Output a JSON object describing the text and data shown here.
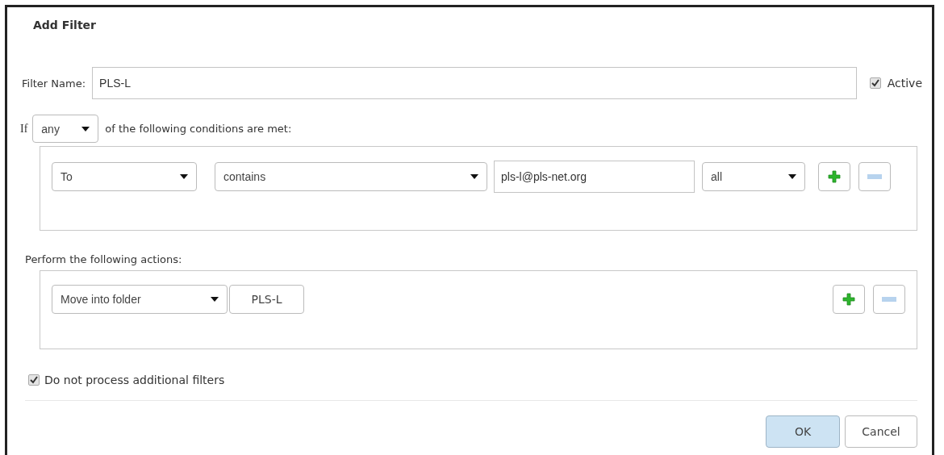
{
  "dialog": {
    "title": "Add Filter"
  },
  "filter_name": {
    "label": "Filter Name:",
    "value": "PLS-L"
  },
  "active": {
    "label": "Active",
    "checked": true
  },
  "condition_intro": {
    "prefix": "If",
    "match": "any",
    "suffix": "of the following conditions are met:"
  },
  "conditions": [
    {
      "field": "To",
      "operator": "contains",
      "value": "pls-l@pls-net.org",
      "scope": "all",
      "add_disabled": false,
      "remove_disabled": true
    }
  ],
  "actions_label": "Perform the following actions:",
  "actions": [
    {
      "action": "Move into folder",
      "folder": "PLS-L",
      "add_disabled": false,
      "remove_disabled": true
    }
  ],
  "stop_processing": {
    "label": "Do not process additional filters",
    "checked": true
  },
  "buttons": [
    {
      "label": "OK",
      "kind": "primary"
    },
    {
      "label": "Cancel",
      "kind": "secondary"
    }
  ]
}
